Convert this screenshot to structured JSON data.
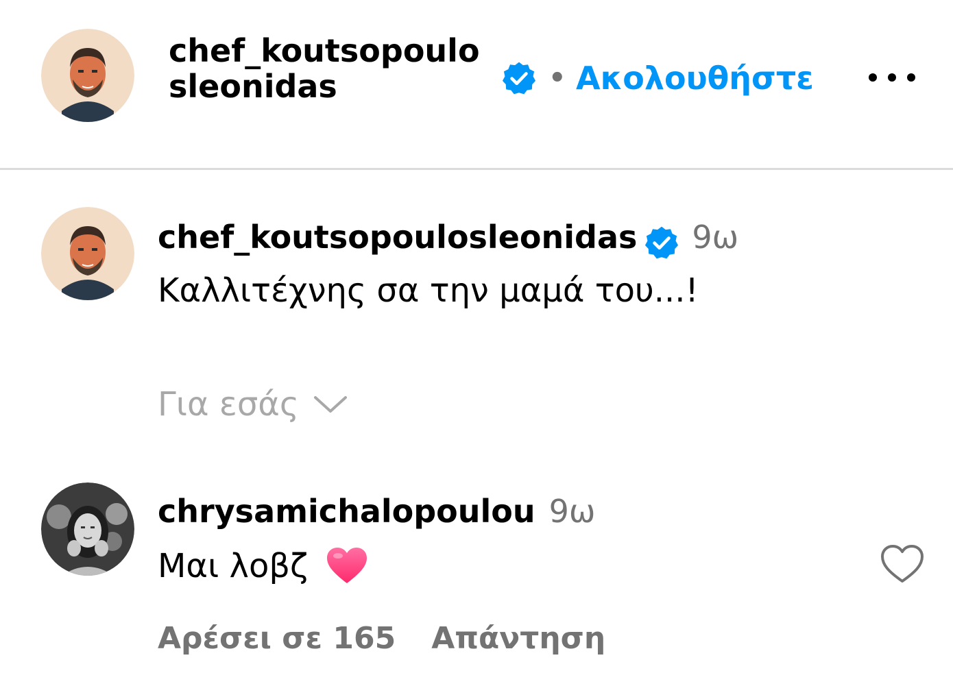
{
  "header": {
    "username": "chef_koutsopoulosleonidas",
    "separator": "•",
    "follow_label": "Ακολουθήστε"
  },
  "caption": {
    "username": "chef_koutsopoulosleonidas",
    "time": "9ω",
    "text": "Καλλιτέχνης σα την μαμά του...!"
  },
  "comments_filter": {
    "label": "Για εσάς"
  },
  "comment": {
    "username": "chrysamichalopoulou",
    "time": "9ω",
    "text": "Μαι λοβζ",
    "likes_label": "Αρέσει σε 165",
    "reply_label": "Απάντηση"
  },
  "colors": {
    "accent": "#0095f6",
    "muted": "#737373",
    "divider": "#dbdbdb",
    "heart": "#ff3d7f"
  }
}
